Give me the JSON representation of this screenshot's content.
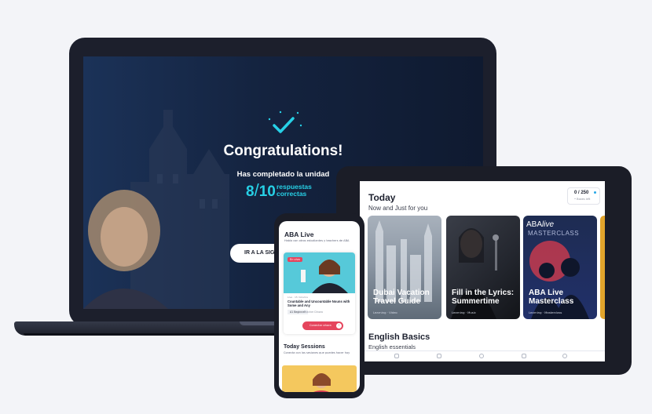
{
  "laptop": {
    "title": "Congratulations!",
    "subtitle": "Has completado la unidad",
    "score_correct": "8",
    "score_total": "10",
    "score_text_line1": "respuestas",
    "score_text_line2": "correctas",
    "next_button": "IR A LA SIG"
  },
  "tablet": {
    "title": "Today",
    "subtitle": "Now and Just for you",
    "progress_value": "0 / 250",
    "progress_label": "• Boxes left",
    "cards": [
      {
        "title": "Dubai Vacation Travel Guide",
        "meta": "Learning · Video"
      },
      {
        "title": "Fill in the Lyrics: Summertime",
        "meta": "Learning · Music"
      },
      {
        "title": "ABA Live Masterclass",
        "meta": "Learning · Masterclass",
        "brand": "ABA",
        "brand_suffix": "live",
        "brand_sub": "MASTERCLASS"
      }
    ],
    "section_title": "English Basics",
    "section_subtitle": "English essentials"
  },
  "phone": {
    "title": "ABA Live",
    "description": "Habla con otros estudiantes y teachers de ABA",
    "badge": "En vivo",
    "card_meta": "Live · 15 minutos",
    "card_title": "Countable and Uncountable Nouns with Some and Any",
    "chip": "A1 Beginner",
    "chip2": "Teacher Dinora",
    "button_label": "Conectar ahora",
    "section_title": "Today Sessions",
    "section_subtitle": "Conecta con las sesiones que puedes hacer hoy"
  },
  "colors": {
    "accent_cyan": "#27d0e6",
    "accent_red": "#e5455d",
    "device_dark": "#1b1d27",
    "background": "#f3f4f8"
  }
}
